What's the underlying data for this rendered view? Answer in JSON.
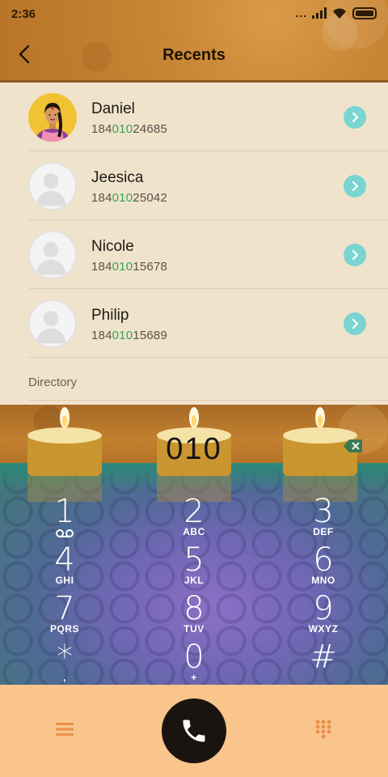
{
  "status_bar": {
    "time": "2:36",
    "more": "..."
  },
  "header": {
    "title": "Recents"
  },
  "contacts": [
    {
      "name": "Daniel",
      "number_prefix": "184",
      "number_match": "010",
      "number_suffix": "24685",
      "avatar": "illustrated-woman"
    },
    {
      "name": "Jeesica",
      "number_prefix": "184",
      "number_match": "010",
      "number_suffix": "25042",
      "avatar": "placeholder"
    },
    {
      "name": "Nicole",
      "number_prefix": "184",
      "number_match": "010",
      "number_suffix": "15678",
      "avatar": "placeholder"
    },
    {
      "name": "Philip",
      "number_prefix": "184",
      "number_match": "010",
      "number_suffix": "15689",
      "avatar": "placeholder"
    }
  ],
  "section": {
    "directory_label": "Directory"
  },
  "dialpad": {
    "typed": "010",
    "keys": [
      {
        "digit": "1",
        "letters": ""
      },
      {
        "digit": "2",
        "letters": "ABC"
      },
      {
        "digit": "3",
        "letters": "DEF"
      },
      {
        "digit": "4",
        "letters": "GHI"
      },
      {
        "digit": "5",
        "letters": "JKL"
      },
      {
        "digit": "6",
        "letters": "MNO"
      },
      {
        "digit": "7",
        "letters": "PQRS"
      },
      {
        "digit": "8",
        "letters": "TUV"
      },
      {
        "digit": "9",
        "letters": "WXYZ"
      },
      {
        "digit": "*",
        "letters": ","
      },
      {
        "digit": "0",
        "letters": "+"
      },
      {
        "digit": "#",
        "letters": ""
      }
    ]
  },
  "colors": {
    "accent_match": "#3aa05a",
    "detail_button": "#7ad5d2",
    "bottom_bar": "#f9c58c",
    "call_button": "#1a1410",
    "bottom_icons": "#e8904a"
  },
  "icons": {
    "back": "chevron-left-icon",
    "detail": "chevron-right-icon",
    "voicemail": "voicemail-icon",
    "backspace": "backspace-icon",
    "menu": "menu-icon",
    "call": "phone-icon",
    "keypad": "keypad-icon"
  }
}
